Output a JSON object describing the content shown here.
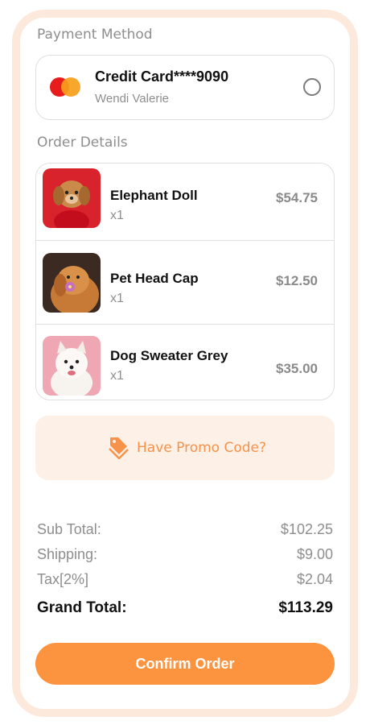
{
  "payment": {
    "section_label": "Payment Method",
    "card_title": "Credit Card****9090",
    "card_holder": "Wendi Valerie",
    "icon": "mastercard-logo"
  },
  "order": {
    "section_label": "Order Details",
    "items": [
      {
        "name": "Elephant Doll",
        "qty": "x1",
        "price": "$54.75",
        "image": "dog-in-red-sweater-photo"
      },
      {
        "name": "Pet Head Cap",
        "qty": "x1",
        "price": "$12.50",
        "image": "golden-retriever-with-flower-photo"
      },
      {
        "name": "Dog Sweater Grey",
        "qty": "x1",
        "price": "$35.00",
        "image": "white-samoyed-photo"
      }
    ]
  },
  "promo": {
    "label": "Have Promo Code?",
    "icon": "tag-icon"
  },
  "summary": {
    "subtotal_label": "Sub Total:",
    "subtotal": "$102.25",
    "shipping_label": "Shipping:",
    "shipping": "$9.00",
    "tax_label": "Tax[2%]",
    "tax": "$2.04",
    "grand_label": "Grand Total:",
    "grand": "$113.29"
  },
  "confirm_label": "Confirm Order",
  "colors": {
    "accent": "#fc943f",
    "frame": "#fde9dc",
    "promo_bg": "#fdf0e6"
  }
}
